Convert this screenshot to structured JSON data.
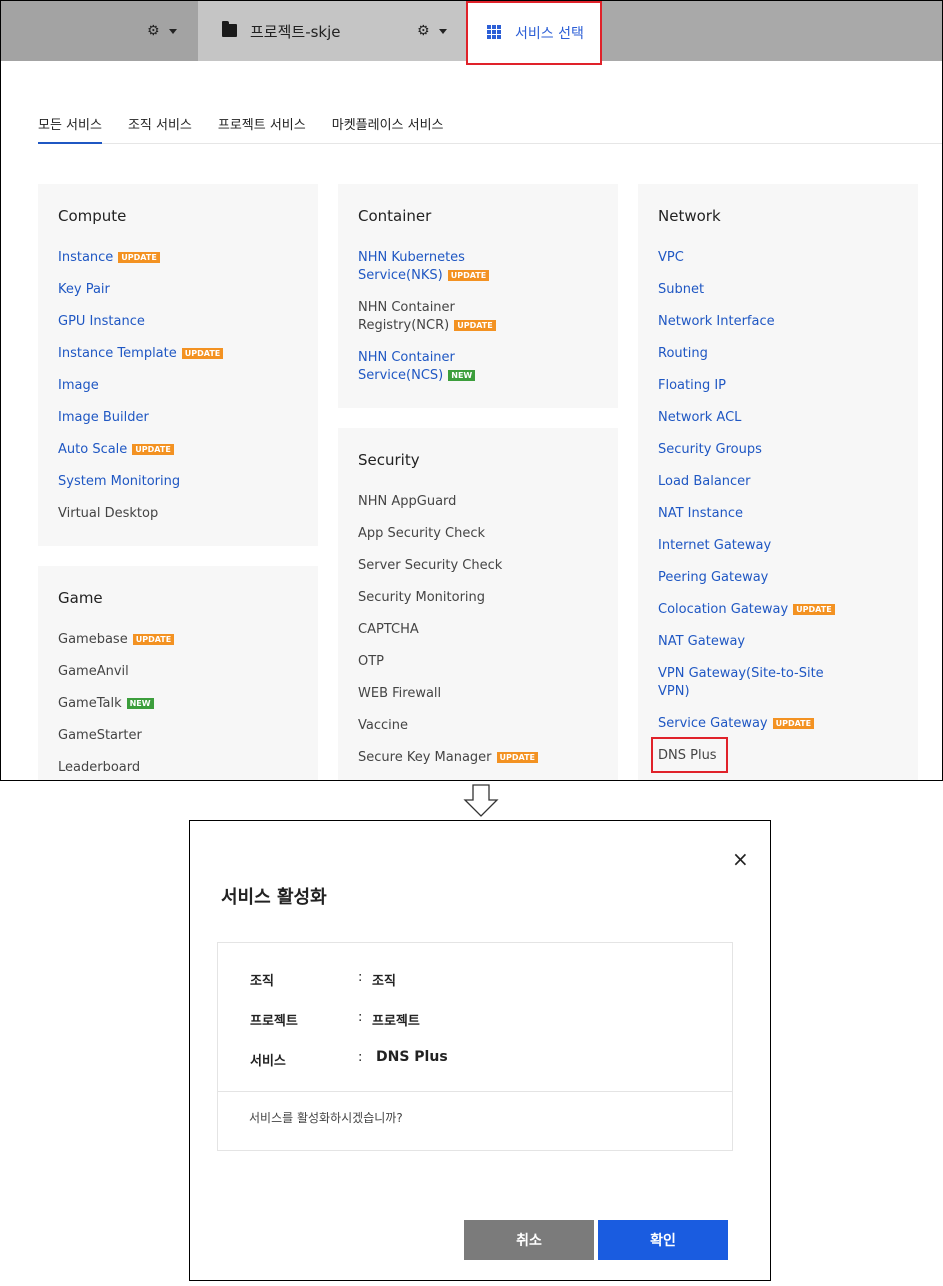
{
  "topbar": {
    "project_name": "프로젝트-skje",
    "service_select_label": "서비스 선택"
  },
  "tabs": [
    "모든 서비스",
    "조직 서비스",
    "프로젝트 서비스",
    "마켓플레이스 서비스"
  ],
  "badges": {
    "update": "UPDATE",
    "new": "NEW"
  },
  "compute": {
    "title": "Compute",
    "items": [
      "Instance",
      "Key Pair",
      "GPU Instance",
      "Instance Template",
      "Image",
      "Image Builder",
      "Auto Scale",
      "System Monitoring",
      "Virtual Desktop"
    ]
  },
  "game": {
    "title": "Game",
    "items": [
      "Gamebase",
      "GameAnvil",
      "GameTalk",
      "GameStarter",
      "Leaderboard"
    ]
  },
  "container": {
    "title": "Container",
    "items": [
      [
        "NHN Kubernetes",
        "Service(NKS)"
      ],
      [
        "NHN Container",
        "Registry(NCR)"
      ],
      [
        "NHN Container",
        "Service(NCS)"
      ]
    ]
  },
  "security": {
    "title": "Security",
    "items": [
      "NHN AppGuard",
      "App Security Check",
      "Server Security Check",
      "Security Monitoring",
      "CAPTCHA",
      "OTP",
      "WEB Firewall",
      "Vaccine",
      "Secure Key Manager"
    ]
  },
  "network": {
    "title": "Network",
    "items": [
      "VPC",
      "Subnet",
      "Network Interface",
      "Routing",
      "Floating IP",
      "Network ACL",
      "Security Groups",
      "Load Balancer",
      "NAT Instance",
      "Internet Gateway",
      "Peering Gateway",
      "Colocation Gateway",
      "NAT Gateway",
      "VPN Gateway(Site-to-Site",
      "VPN)",
      "Service Gateway",
      "DNS Plus"
    ]
  },
  "dialog": {
    "title": "서비스 활성화",
    "org_label": "조직",
    "org_value": "조직",
    "project_label": "프로젝트",
    "project_value": "프로젝트",
    "service_label": "서비스",
    "service_value": "DNS Plus",
    "colon": ":",
    "question": "서비스를 활성화하시겠습니까?",
    "cancel": "취소",
    "confirm": "확인",
    "close": "×"
  }
}
